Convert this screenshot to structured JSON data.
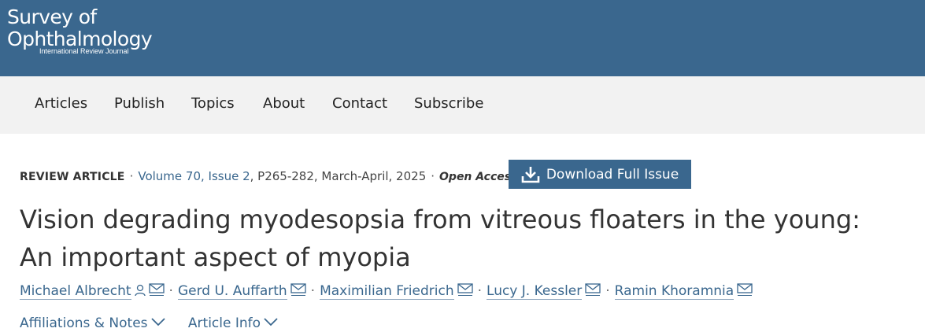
{
  "journal": {
    "name_line1": "Survey of",
    "name_line2": "Ophthalmology",
    "tagline": "International Review Journal"
  },
  "nav": {
    "items": [
      "Articles",
      "Publish",
      "Topics",
      "About",
      "Contact",
      "Subscribe"
    ]
  },
  "article": {
    "type": "REVIEW ARTICLE",
    "volume_issue": "Volume 70, Issue 2",
    "pages_date": ", P265-282, March-April, 2025",
    "access": "Open Access",
    "download_label": "Download Full Issue",
    "title_line1": "Vision degrading myodesopsia from vitreous floaters in the young:",
    "title_line2": "An important aspect of myopia",
    "authors": [
      "Michael Albrecht",
      "Gerd U. Auffarth",
      "Maximilian Friedrich",
      "Lucy J. Kessler",
      "Ramin Khoramnia"
    ],
    "affiliations_label": "Affiliations & Notes",
    "article_info_label": "Article Info"
  },
  "colors": {
    "brand": "#3a678e",
    "nav_bg": "#f2f2f2"
  }
}
